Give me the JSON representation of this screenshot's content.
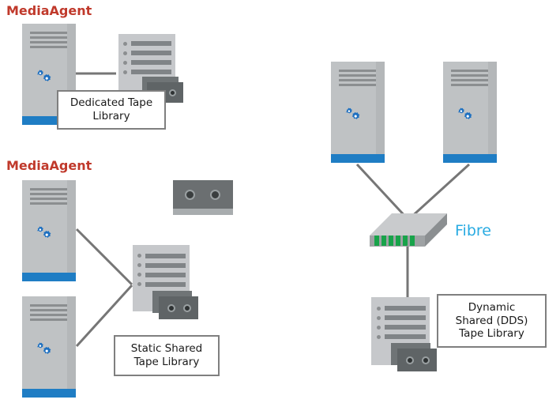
{
  "diagram": {
    "title_top": "MediaAgent",
    "title_mid": "MediaAgent",
    "fibre_label": "Fibre",
    "callouts": {
      "dedicated": {
        "line1": "Dedicated Tape",
        "line2": "Library"
      },
      "static": {
        "line1": "Static Shared",
        "line2": "Tape Library"
      },
      "dynamic": {
        "line1": "Dynamic",
        "line2": "Shared (DDS)",
        "line3": "Tape Library"
      }
    },
    "icons": {
      "server": "server-tower-icon",
      "gears": "gears-icon",
      "tape_library": "tape-library-icon",
      "tape_cartridge": "tape-cartridge-icon",
      "switch": "fibre-switch-icon"
    },
    "colors": {
      "title_red": "#C0392B",
      "fibre_blue": "#29ABE2",
      "server_body": "#BFC2C4",
      "server_foot": "#1F7DC4",
      "library_body": "#C6C8CB",
      "cartridge_dark": "#5F6466",
      "line_gray": "#767676",
      "callout_border": "#7F7F7F",
      "switch_green": "#18A34A"
    },
    "nodes": [
      {
        "id": "ma-1",
        "type": "server-tower",
        "label": "MediaAgent"
      },
      {
        "id": "lib-1",
        "type": "tape-library",
        "label": "Dedicated Tape Library"
      },
      {
        "id": "ma-2",
        "type": "server-tower",
        "label": "MediaAgent"
      },
      {
        "id": "ma-3",
        "type": "server-tower",
        "label": "MediaAgent"
      },
      {
        "id": "tape-1",
        "type": "tape-cartridge",
        "label": ""
      },
      {
        "id": "lib-2",
        "type": "tape-library",
        "label": "Static Shared Tape Library"
      },
      {
        "id": "ma-4",
        "type": "server-tower",
        "label": ""
      },
      {
        "id": "ma-5",
        "type": "server-tower",
        "label": ""
      },
      {
        "id": "sw-1",
        "type": "fibre-switch",
        "label": "Fibre"
      },
      {
        "id": "lib-3",
        "type": "tape-library",
        "label": "Dynamic Shared (DDS) Tape Library"
      }
    ],
    "connections": [
      {
        "from": "ma-1",
        "to": "lib-1"
      },
      {
        "from": "ma-2",
        "to": "lib-2"
      },
      {
        "from": "ma-3",
        "to": "lib-2"
      },
      {
        "from": "ma-4",
        "to": "sw-1"
      },
      {
        "from": "ma-5",
        "to": "sw-1"
      },
      {
        "from": "sw-1",
        "to": "lib-3"
      }
    ]
  }
}
